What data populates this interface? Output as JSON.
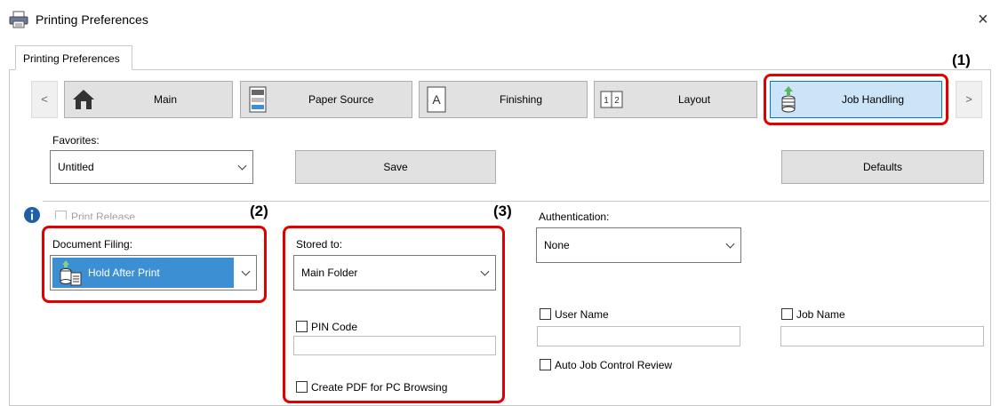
{
  "window": {
    "title": "Printing Preferences",
    "close_symbol": "×"
  },
  "tabs": [
    {
      "label": "Printing Preferences"
    }
  ],
  "nav": {
    "prev_symbol": "<",
    "next_symbol": ">",
    "buttons": [
      {
        "label": "Main",
        "icon": "home-icon"
      },
      {
        "label": "Paper Source",
        "icon": "paper-tray-icon"
      },
      {
        "label": "Finishing",
        "icon": "finishing-icon"
      },
      {
        "label": "Layout",
        "icon": "layout-icon"
      },
      {
        "label": "Job Handling",
        "icon": "job-handling-icon",
        "selected": true
      }
    ]
  },
  "favorites": {
    "label": "Favorites:",
    "value": "Untitled",
    "save_label": "Save",
    "defaults_label": "Defaults"
  },
  "print_release": {
    "label": "Print Release",
    "checked": false,
    "enabled": false
  },
  "document_filing": {
    "label": "Document Filing:",
    "value": "Hold After Print"
  },
  "stored_to": {
    "label": "Stored to:",
    "value": "Main Folder"
  },
  "pin_code": {
    "label": "PIN Code",
    "checked": false,
    "value": ""
  },
  "create_pdf": {
    "label": "Create PDF for PC Browsing",
    "checked": false
  },
  "authentication": {
    "label": "Authentication:",
    "value": "None"
  },
  "user_name": {
    "label": "User Name",
    "checked": false,
    "value": ""
  },
  "job_name": {
    "label": "Job Name",
    "checked": false,
    "value": ""
  },
  "auto_job_control": {
    "label": "Auto Job Control Review",
    "checked": false
  },
  "callouts": {
    "c1": "(1)",
    "c2": "(2)",
    "c3": "(3)"
  },
  "colors": {
    "highlight": "#e00000",
    "selected_bg": "#cce4f7",
    "selected_border": "#0078d7",
    "filing_bg": "#3d8fd4"
  }
}
